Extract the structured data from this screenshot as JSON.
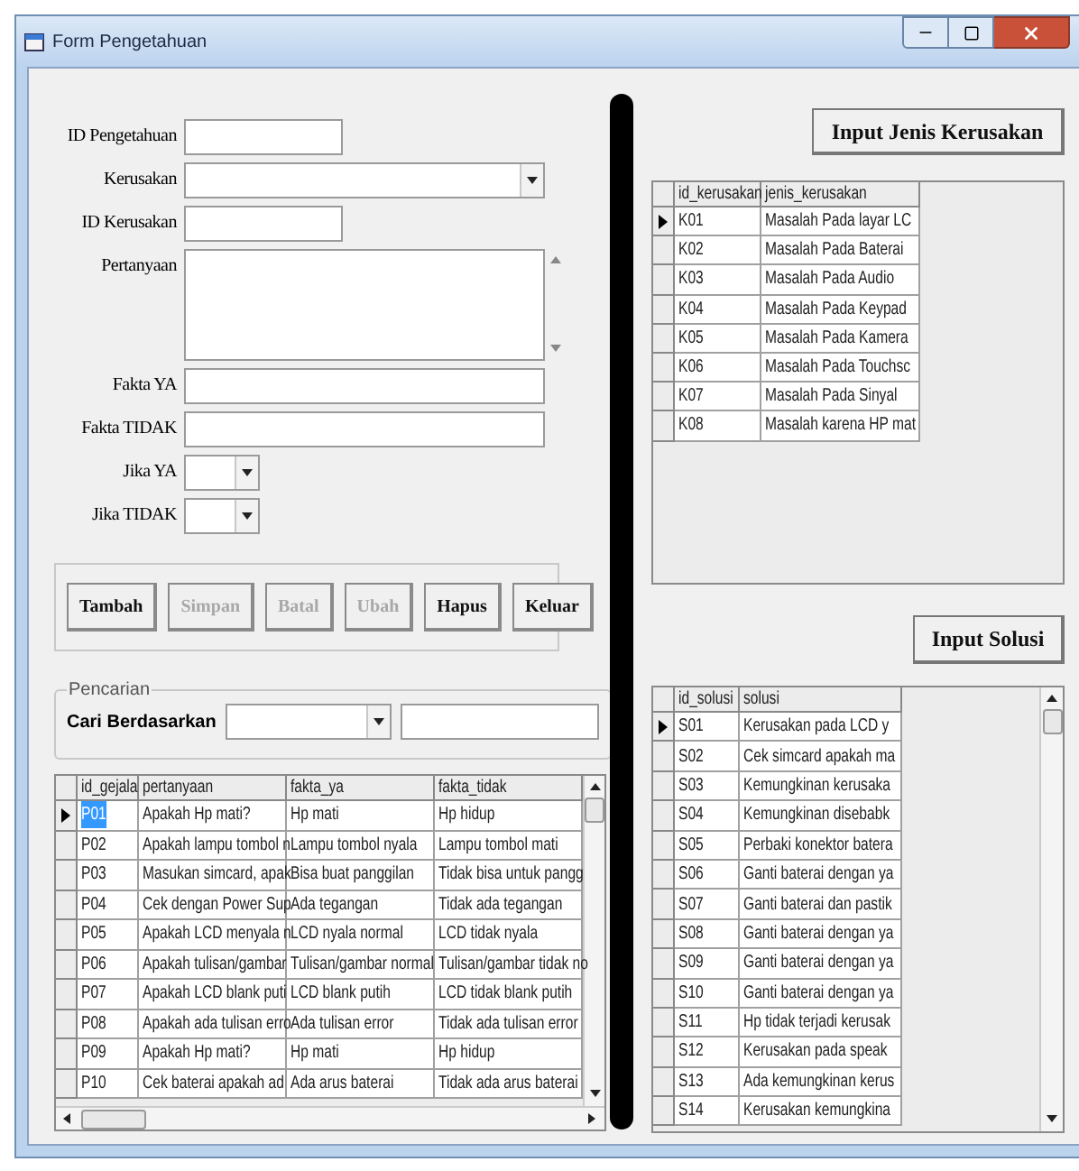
{
  "window": {
    "title": "Form Pengetahuan"
  },
  "form": [
    {
      "label": "ID Pengetahuan",
      "kind": "short_text"
    },
    {
      "label": "Kerusakan",
      "kind": "combo"
    },
    {
      "label": "ID Kerusakan",
      "kind": "short_text"
    },
    {
      "label": "Pertanyaan",
      "kind": "memo"
    },
    {
      "label": "Fakta YA",
      "kind": "long_text"
    },
    {
      "label": "Fakta TIDAK",
      "kind": "long_text"
    },
    {
      "label": "Jika YA",
      "kind": "small_combo"
    },
    {
      "label": "Jika TIDAK",
      "kind": "small_combo"
    }
  ],
  "buttons": [
    {
      "label": "Tambah",
      "disabled": false
    },
    {
      "label": "Simpan",
      "disabled": true
    },
    {
      "label": "Batal",
      "disabled": true
    },
    {
      "label": "Ubah",
      "disabled": true
    },
    {
      "label": "Hapus",
      "disabled": false
    },
    {
      "label": "Keluar",
      "disabled": false
    }
  ],
  "search": {
    "title": "Pencarian",
    "label": "Cari Berdasarkan"
  },
  "gejala_table": {
    "focused": true,
    "columns": [
      "id_gejala",
      "pertanyaan",
      "fakta_ya",
      "fakta_tidak"
    ],
    "rows": [
      {
        "selected": true,
        "cells": [
          "P01",
          "Apakah Hp mati?",
          "Hp mati",
          "Hp hidup"
        ]
      },
      {
        "selected": false,
        "cells": [
          "P02",
          "Apakah lampu tombol n",
          "Lampu tombol nyala",
          "Lampu tombol mati"
        ]
      },
      {
        "selected": false,
        "cells": [
          "P03",
          "Masukan simcard, apak",
          "Bisa buat panggilan",
          "Tidak bisa untuk pangg"
        ]
      },
      {
        "selected": false,
        "cells": [
          "P04",
          "Cek dengan Power Sup",
          "Ada tegangan",
          "Tidak ada tegangan"
        ]
      },
      {
        "selected": false,
        "cells": [
          "P05",
          "Apakah LCD menyala n",
          "LCD nyala normal",
          "LCD tidak nyala"
        ]
      },
      {
        "selected": false,
        "cells": [
          "P06",
          "Apakah tulisan/gambar",
          "Tulisan/gambar normal",
          "Tulisan/gambar tidak no"
        ]
      },
      {
        "selected": false,
        "cells": [
          "P07",
          "Apakah LCD blank puti",
          "LCD blank putih",
          "LCD tidak blank putih"
        ]
      },
      {
        "selected": false,
        "cells": [
          "P08",
          "Apakah ada tulisan erro",
          "Ada tulisan error",
          "Tidak ada tulisan error"
        ]
      },
      {
        "selected": false,
        "cells": [
          "P09",
          "Apakah Hp mati?",
          "Hp mati",
          "Hp hidup"
        ]
      },
      {
        "selected": false,
        "cells": [
          "P10",
          "Cek baterai apakah ad",
          "Ada arus baterai",
          "Tidak ada arus baterai"
        ]
      }
    ]
  },
  "kerusakan_button": "Input Jenis Kerusakan",
  "kerusakan_table": {
    "focused": false,
    "columns": [
      "id_kerusakan",
      "jenis_kerusakan"
    ],
    "rows": [
      {
        "selected": true,
        "cells": [
          "K01",
          "Masalah Pada layar LC"
        ]
      },
      {
        "selected": false,
        "cells": [
          "K02",
          "Masalah Pada Baterai"
        ]
      },
      {
        "selected": false,
        "cells": [
          "K03",
          "Masalah Pada Audio"
        ]
      },
      {
        "selected": false,
        "cells": [
          "K04",
          "Masalah Pada Keypad"
        ]
      },
      {
        "selected": false,
        "cells": [
          "K05",
          "Masalah Pada Kamera"
        ]
      },
      {
        "selected": false,
        "cells": [
          "K06",
          "Masalah Pada Touchsc"
        ]
      },
      {
        "selected": false,
        "cells": [
          "K07",
          "Masalah Pada Sinyal"
        ]
      },
      {
        "selected": false,
        "cells": [
          "K08",
          "Masalah karena HP mat"
        ]
      }
    ]
  },
  "solusi_button": "Input Solusi",
  "solusi_table": {
    "focused": false,
    "columns": [
      "id_solusi",
      "solusi"
    ],
    "rows": [
      {
        "selected": true,
        "cells": [
          "S01",
          "Kerusakan pada LCD y"
        ]
      },
      {
        "selected": false,
        "cells": [
          "S02",
          "Cek simcard apakah ma"
        ]
      },
      {
        "selected": false,
        "cells": [
          "S03",
          "Kemungkinan kerusaka"
        ]
      },
      {
        "selected": false,
        "cells": [
          "S04",
          "Kemungkinan disebabk"
        ]
      },
      {
        "selected": false,
        "cells": [
          "S05",
          "Perbaki konektor batera"
        ]
      },
      {
        "selected": false,
        "cells": [
          "S06",
          "Ganti baterai dengan ya"
        ]
      },
      {
        "selected": false,
        "cells": [
          "S07",
          "Ganti baterai dan pastik"
        ]
      },
      {
        "selected": false,
        "cells": [
          "S08",
          "Ganti baterai dengan ya"
        ]
      },
      {
        "selected": false,
        "cells": [
          "S09",
          "Ganti baterai dengan ya"
        ]
      },
      {
        "selected": false,
        "cells": [
          "S10",
          "Ganti baterai dengan ya"
        ]
      },
      {
        "selected": false,
        "cells": [
          "S11",
          "Hp tidak terjadi kerusak"
        ]
      },
      {
        "selected": false,
        "cells": [
          "S12",
          "Kerusakan pada speak"
        ]
      },
      {
        "selected": false,
        "cells": [
          "S13",
          "Ada kemungkinan kerus"
        ]
      },
      {
        "selected": false,
        "cells": [
          "S14",
          "Kerusakan kemungkina"
        ]
      }
    ]
  }
}
